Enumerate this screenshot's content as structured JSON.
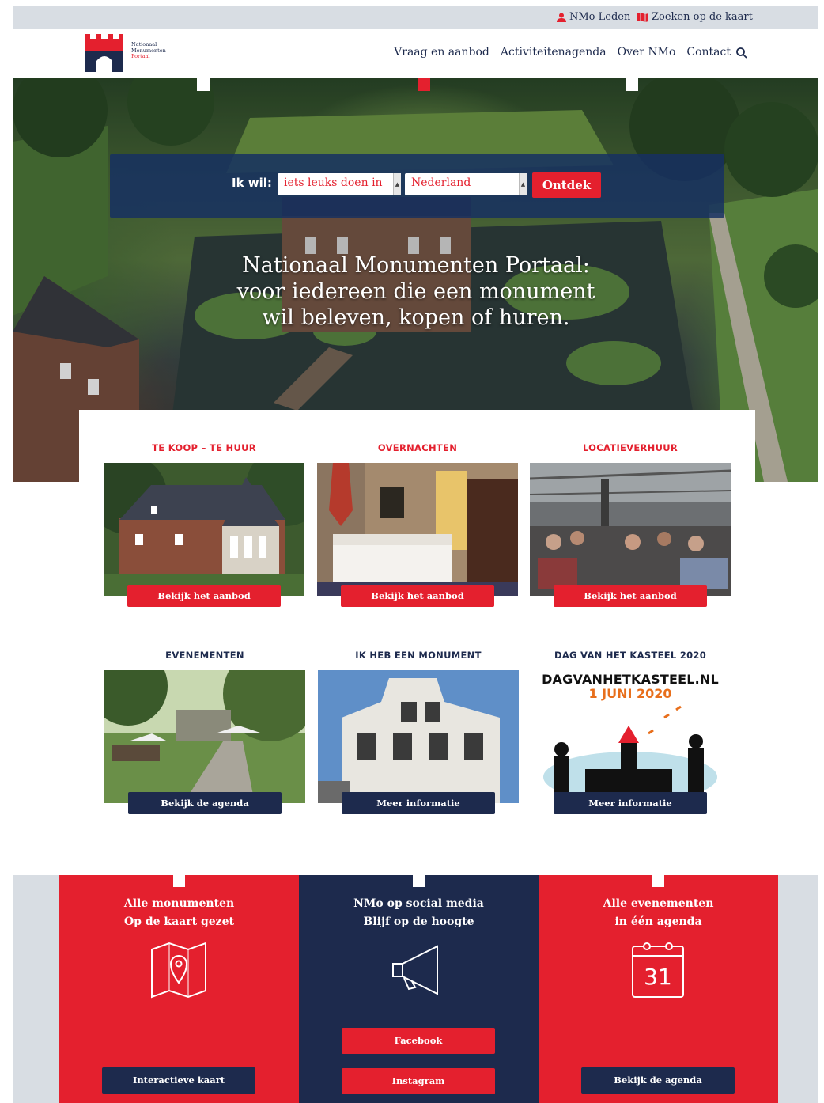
{
  "utilbar": {
    "members_label": "NMo Leden",
    "map_label": "Zoeken op de kaart"
  },
  "logo": {
    "line1": "Nationaal",
    "line2": "Monumenten",
    "line3": "Portaal"
  },
  "nav": {
    "items": [
      "Vraag en aanbod",
      "Activiteitenagenda",
      "Over NMo",
      "Contact"
    ],
    "search_icon": "search-icon"
  },
  "hero": {
    "search_label": "Ik wil:",
    "select_activity": "iets leuks doen in",
    "select_region": "Nederland",
    "submit_label": "Ontdek",
    "title_line1": "Nationaal Monumenten Portaal:",
    "title_line2": "voor iedereen die een monument",
    "title_line3": "wil beleven, kopen of huren."
  },
  "tiles": [
    {
      "title": "TE KOOP – TE HUUR",
      "button": "Bekijk het aanbod"
    },
    {
      "title": "OVERNACHTEN",
      "button": "Bekijk het aanbod"
    },
    {
      "title": "LOCATIEVERHUUR",
      "button": "Bekijk het aanbod"
    },
    {
      "title": "EVENEMENTEN",
      "button": "Bekijk de agenda"
    },
    {
      "title": "IK HEB EEN MONUMENT",
      "button": "Meer informatie"
    },
    {
      "title": "DAG VAN HET KASTEEL 2020",
      "button": "Meer informatie",
      "poster_line1": "DAGVANHETKASTEEL.NL",
      "poster_line2": "1 JUNI 2020"
    }
  ],
  "columns": [
    {
      "title_line1": "Alle monumenten",
      "title_line2": "Op de kaart gezet",
      "icon": "map-pin-icon",
      "buttons": [
        "Interactieve kaart"
      ]
    },
    {
      "title_line1": "NMo op social media",
      "title_line2": "Blijf op de hoogte",
      "icon": "megaphone-icon",
      "buttons": [
        "Facebook",
        "Instagram"
      ]
    },
    {
      "title_line1": "Alle evenementen",
      "title_line2": "in één agenda",
      "icon": "calendar-icon",
      "calendar_day": "31",
      "buttons": [
        "Bekijk de agenda"
      ]
    }
  ],
  "colors": {
    "brand_red": "#e4202e",
    "brand_navy": "#1d2a4d",
    "grey_band": "#d8dde3"
  }
}
